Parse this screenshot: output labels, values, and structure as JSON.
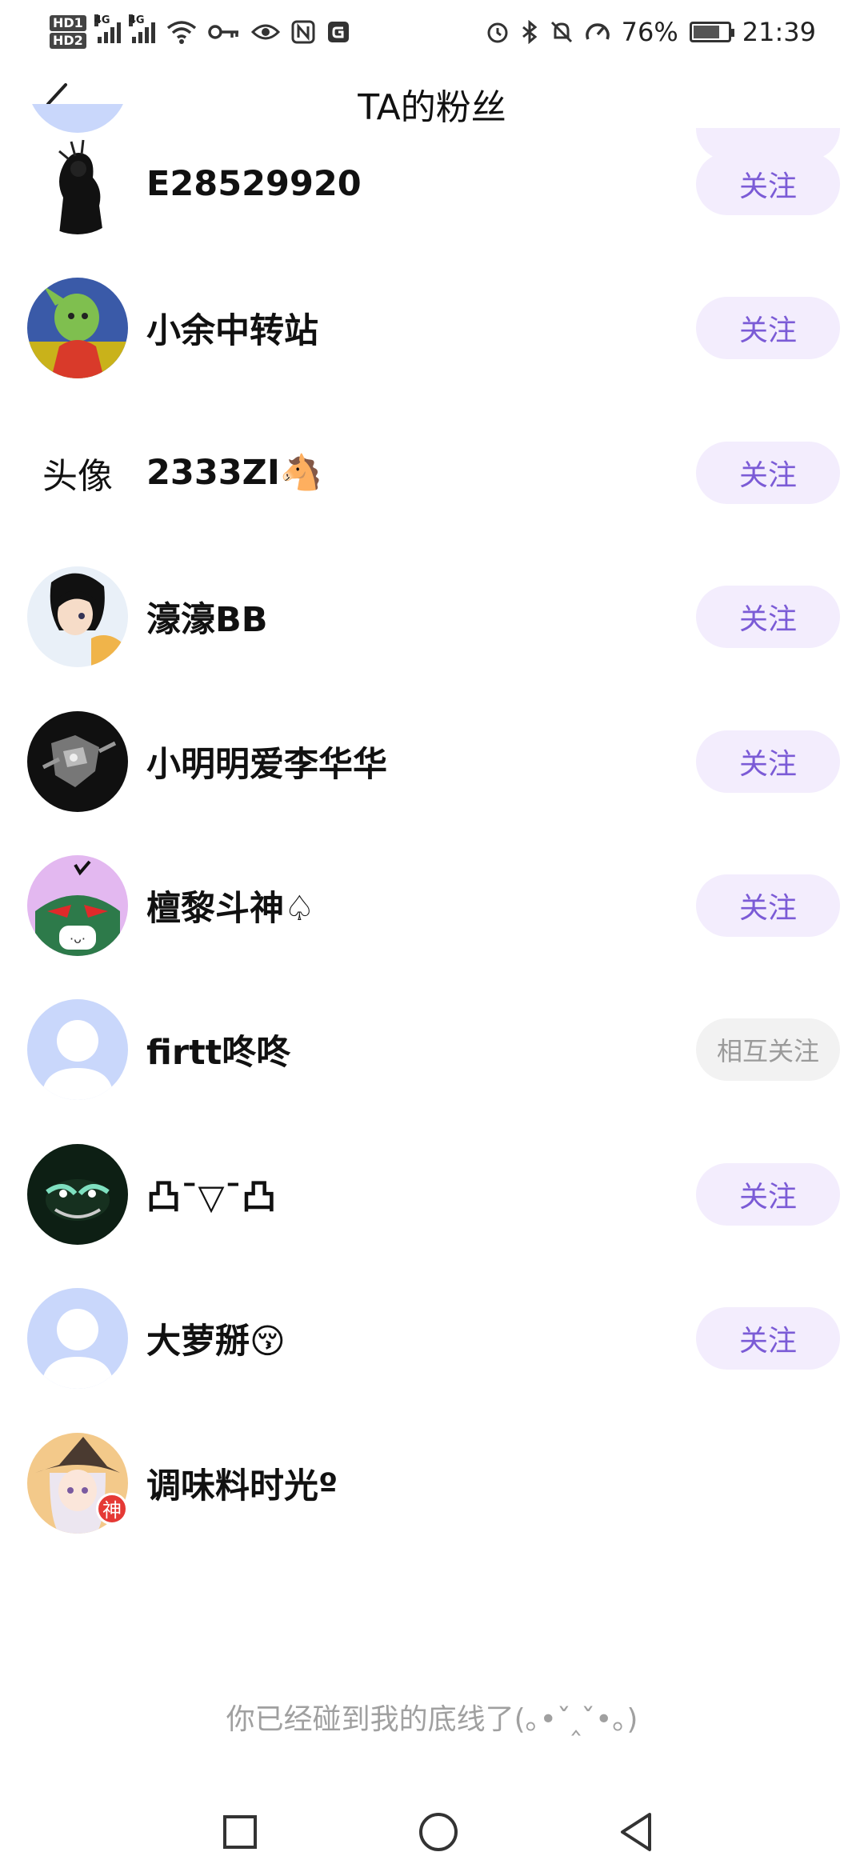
{
  "status_bar": {
    "hd1": "HD1",
    "hd2": "HD2",
    "net1": "4G",
    "net2": "4G",
    "battery_text": "76%",
    "battery_level": 0.76,
    "time": "21:39"
  },
  "header": {
    "title": "TA的粉丝"
  },
  "followers": [
    {
      "name": "E28529920",
      "button": "关注",
      "mutual": false,
      "avatar": "dark-figure"
    },
    {
      "name": "小余中转站",
      "button": "关注",
      "mutual": false,
      "avatar": "anime-green"
    },
    {
      "name": "2333ZI🐴",
      "button": "关注",
      "mutual": false,
      "avatar_text": "头像"
    },
    {
      "name": "濠濠BB",
      "button": "关注",
      "mutual": false,
      "avatar": "anime-girl"
    },
    {
      "name": "小明明爱李华华",
      "button": "关注",
      "mutual": false,
      "avatar": "robot-dark"
    },
    {
      "name": "檀黎斗神♤",
      "button": "关注",
      "mutual": false,
      "avatar": "pink-mask"
    },
    {
      "name": "firtt咚咚",
      "button": "相互关注",
      "mutual": true,
      "avatar": "default"
    },
    {
      "name": "凸ˉ▽ˉ凸",
      "button": "关注",
      "mutual": false,
      "avatar": "dark-green"
    },
    {
      "name": "大萝掰😚",
      "button": "关注",
      "mutual": false,
      "avatar": "default"
    },
    {
      "name": "调味料时光º",
      "button": "",
      "mutual": false,
      "avatar": "witch-girl",
      "badge": "神"
    }
  ],
  "footer": {
    "note": "你已经碰到我的底线了(｡•ˇ‸ˇ•｡)"
  },
  "colors": {
    "follow_bg": "#f3edfd",
    "follow_text": "#7b5bd6",
    "mutual_bg": "#f2f2f2",
    "mutual_text": "#9a9a9a"
  }
}
